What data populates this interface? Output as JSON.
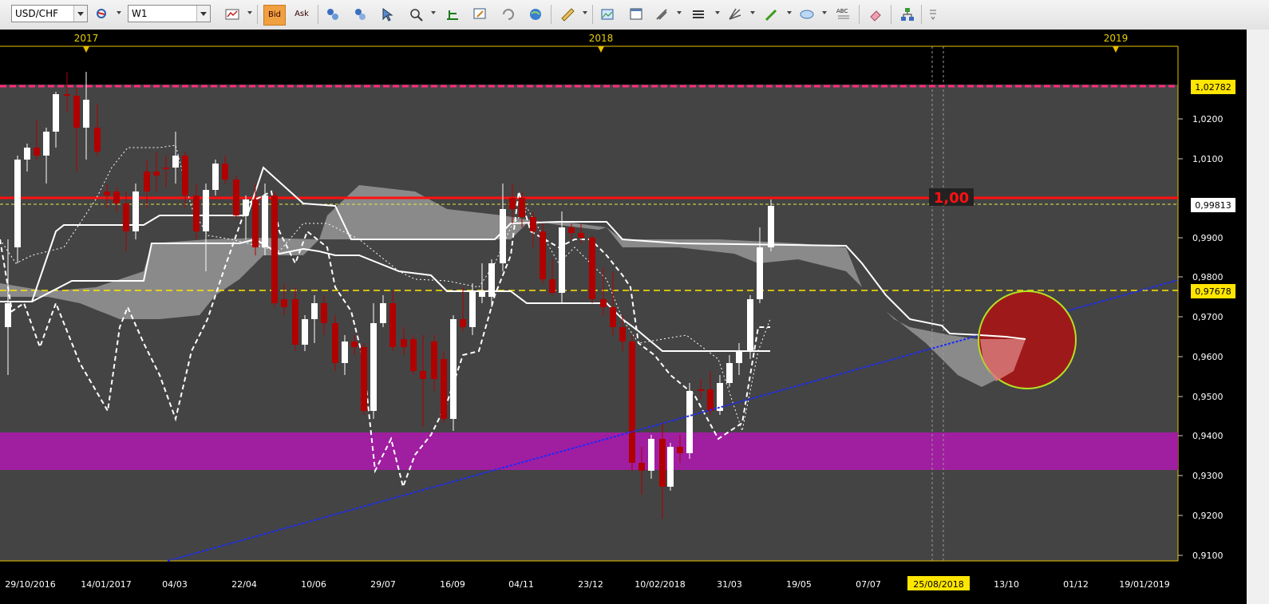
{
  "toolbar": {
    "symbol": "USD/CHF",
    "timeframe": "W1",
    "bid_label": "Bid",
    "ask_label": "Ask",
    "icons": [
      "symbol-search-icon",
      "chart-type-icon",
      "indicator-icon",
      "object-icon",
      "zoom-icon",
      "drawing-icon",
      "template-icon",
      "refresh-icon",
      "globe-icon",
      "ruler-icon",
      "image-icon",
      "window-icon",
      "tools-icon",
      "lines-icon",
      "fibonacci-icon",
      "pencil-icon",
      "shape-icon",
      "text-icon",
      "eraser-icon",
      "tree-icon",
      "settings-icon"
    ]
  },
  "chart": {
    "years": [
      "2017",
      "2018",
      "2019"
    ],
    "date_labels": [
      "29/10/2016",
      "14/01/2017",
      "04/03",
      "22/04",
      "10/06",
      "29/07",
      "16/09",
      "04/11",
      "23/12",
      "10/02/2018",
      "31/03",
      "19/05",
      "07/07",
      "25/08/2018",
      "13/10",
      "01/12",
      "19/01/2019"
    ],
    "price_ticks": [
      "1,0200",
      "1,0100",
      "0,9900",
      "0,9800",
      "0,9700",
      "0,9600",
      "0,9500",
      "0,9400",
      "0,9300",
      "0,9200",
      "0,9100"
    ],
    "markers": {
      "top": "1,02782",
      "level_line": "0,99813",
      "yellow_line": "0,97678"
    },
    "level_label": "1,00",
    "crosshair_date": "25/08/2018",
    "colors": {
      "bull_candle": "#ffffff",
      "bear_candle": "#b00000",
      "cloud": "#8a8a8a",
      "resistance": "#ff1010",
      "support_zone": "#a01ea0",
      "trendline": "#1a2aff",
      "marker_yellow": "#ffe600",
      "top_line": "#ff2a7a"
    }
  }
}
